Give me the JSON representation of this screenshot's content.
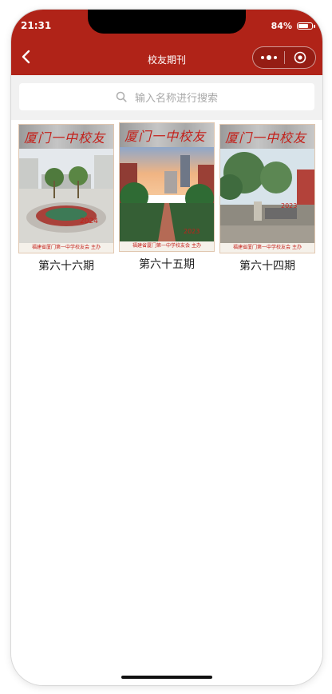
{
  "status_bar": {
    "time": "21:31",
    "battery": "84%",
    "battery_level": 0.84
  },
  "nav": {
    "title": "校友期刊"
  },
  "search": {
    "placeholder": "输入名称进行搜索"
  },
  "magazines": [
    {
      "label": "第六十六期",
      "cover_title": "厦门一中校友",
      "cover_footer": "福建省厦门第一中学校友会 主办"
    },
    {
      "label": "第六十五期",
      "cover_title": "厦门一中校友",
      "cover_footer": "福建省厦门第一中学校友会 主办"
    },
    {
      "label": "第六十四期",
      "cover_title": "厦门一中校友",
      "cover_footer": "福建省厦门第一中学校友会 主办"
    }
  ],
  "colors": {
    "brand": "#b02318",
    "background": "#f1f1f1"
  }
}
